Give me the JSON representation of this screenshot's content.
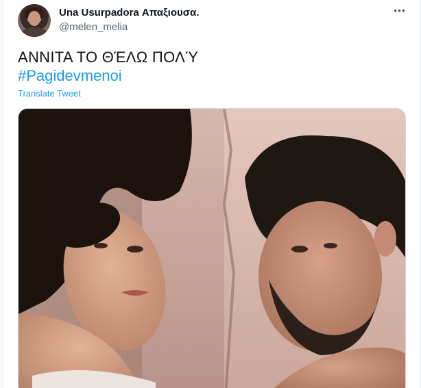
{
  "tweet": {
    "display_name": "Una Usurpadora Απαξιουσα.",
    "handle": "@melen_melia",
    "more_icon": "more-horizontal-icon",
    "text": "ΑΝΝΙΤΑ ΤΟ ΘΈΛΩ ΠΟΛΎ",
    "hashtag": "#Pagidevmenoi",
    "translate_label": "Translate Tweet"
  },
  "colors": {
    "text_primary": "#0f1419",
    "text_secondary": "#536471",
    "link": "#1d9bf0"
  }
}
